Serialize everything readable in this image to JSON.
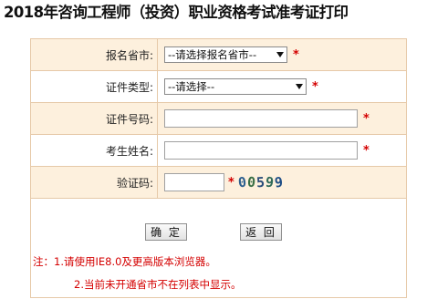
{
  "title": "2018年咨询工程师（投资）职业资格考试准考证打印",
  "form": {
    "province": {
      "label": "报名省市:",
      "selected": "--请选择报名省市--",
      "required_mark": "*"
    },
    "id_type": {
      "label": "证件类型:",
      "selected": "--请选择--",
      "required_mark": "*"
    },
    "id_number": {
      "label": "证件号码:",
      "value": "",
      "required_mark": "*"
    },
    "name": {
      "label": "考生姓名:",
      "value": "",
      "required_mark": "*"
    },
    "captcha": {
      "label": "验证码:",
      "value": "",
      "required_mark": "*",
      "image_text": [
        "0",
        "0",
        "5",
        "9",
        "9"
      ]
    }
  },
  "buttons": {
    "confirm": "确 定",
    "back": "返 回"
  },
  "notes": {
    "line1": "注：1.请使用IE8.0及更高版本浏览器。",
    "line2": "2.当前未开通省市不在列表中显示。"
  },
  "colors": {
    "border": "#e6c9a8",
    "shaded_row": "#fdf0dd",
    "required": "#d40000"
  }
}
